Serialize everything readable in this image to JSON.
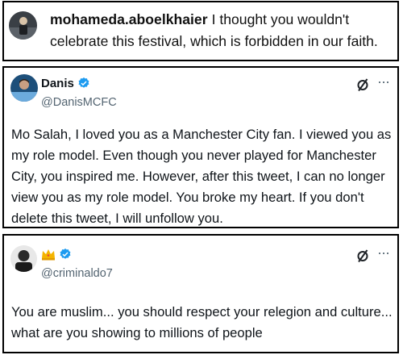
{
  "instagram_comment": {
    "username": "mohameda.aboelkhaier",
    "text": "I thought you wouldn't celebrate this festival, which is forbidden in our faith."
  },
  "tweet1": {
    "display_name": "Danis",
    "handle": "@DanisMCFC",
    "verified_color": "#1d9bf0",
    "text": "Mo Salah, I loved you as a Manchester City fan. I viewed you as my role model. Even though you never played for Manchester City, you inspired me. However, after this tweet, I can no longer view you as my role model. You broke my heart. If you don't delete this tweet, I will unfollow you.",
    "icons": [
      "grok-icon",
      "more-icon"
    ]
  },
  "tweet2": {
    "name_emoji": "crown",
    "handle": "@criminaldo7",
    "verified_color": "#1d9bf0",
    "text": "You are muslim... you should respect your relegion and culture... what are you showing to millions of people",
    "icons": [
      "grok-icon",
      "more-icon"
    ]
  },
  "more_glyph": "···"
}
